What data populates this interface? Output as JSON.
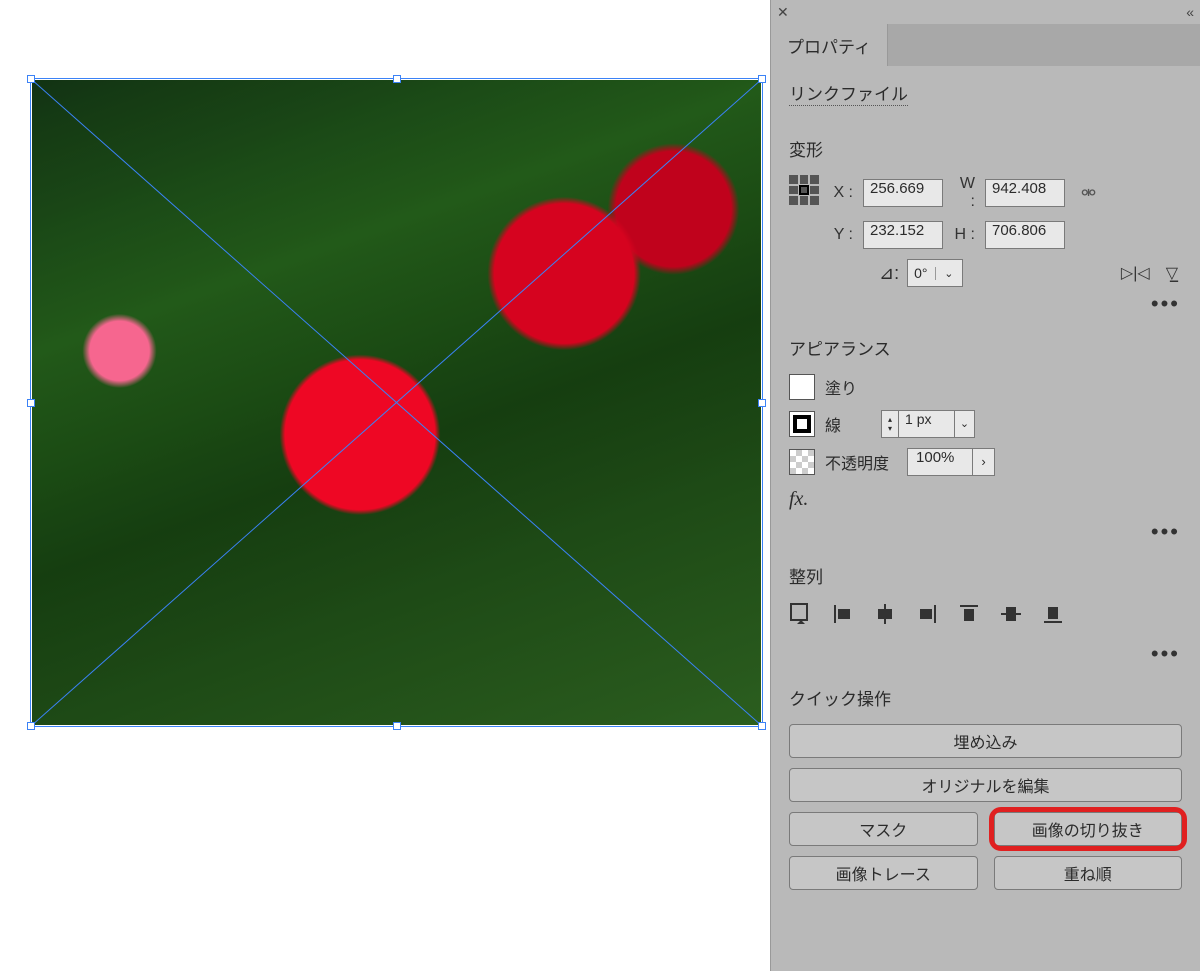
{
  "panel": {
    "tab_label": "プロパティ",
    "link_file": "リンクファイル",
    "transform": {
      "title": "変形",
      "x_label": "X :",
      "y_label": "Y :",
      "w_label": "W :",
      "h_label": "H :",
      "x": "256.669",
      "y": "232.152",
      "w": "942.408",
      "h": "706.806",
      "rotation": "0°"
    },
    "appearance": {
      "title": "アピアランス",
      "fill_label": "塗り",
      "stroke_label": "線",
      "stroke_width": "1 px",
      "opacity_label": "不透明度",
      "opacity": "100%"
    },
    "align": {
      "title": "整列"
    },
    "quick": {
      "title": "クイック操作",
      "embed": "埋め込み",
      "edit_original": "オリジナルを編集",
      "mask": "マスク",
      "crop_image": "画像の切り抜き",
      "image_trace": "画像トレース",
      "arrange": "重ね順"
    }
  }
}
